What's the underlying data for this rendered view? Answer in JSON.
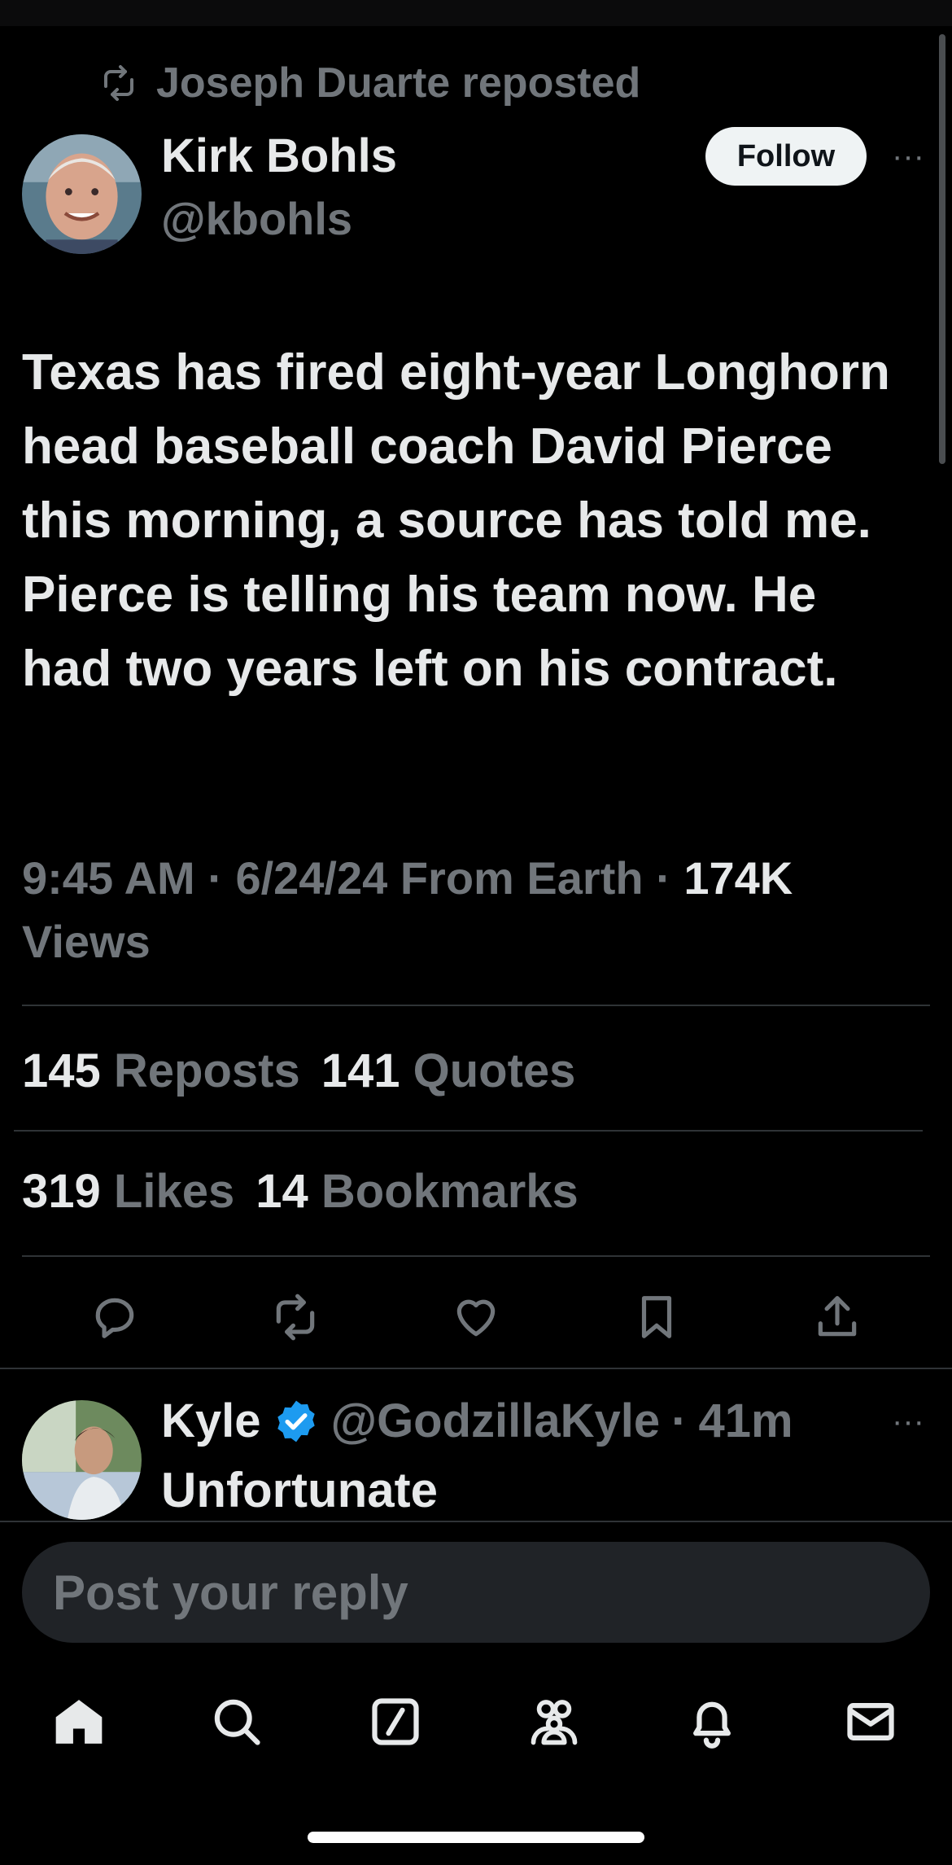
{
  "repost": {
    "text": "Joseph Duarte reposted"
  },
  "author": {
    "name": "Kirk Bohls",
    "handle": "@kbohls"
  },
  "follow_label": "Follow",
  "more_label": "···",
  "tweet": {
    "text": "Texas has fired eight-year Longhorn head baseball coach David Pierce this morning, a source has told me. Pierce is telling his team now. He had two years left on his contract.",
    "time": "9:45 AM",
    "date": "6/24/24",
    "location": "From Earth",
    "views_count": "174K",
    "views_label": "Views"
  },
  "stats": {
    "reposts": {
      "count": "145",
      "label": "Reposts"
    },
    "quotes": {
      "count": "141",
      "label": "Quotes"
    },
    "likes": {
      "count": "319",
      "label": "Likes"
    },
    "bookmarks": {
      "count": "14",
      "label": "Bookmarks"
    }
  },
  "actions": [
    "reply-icon",
    "repost-icon",
    "like-icon",
    "bookmark-icon",
    "share-icon"
  ],
  "reply": {
    "name": "Kyle",
    "handle": "@GodzillaKyle",
    "time": "41m",
    "text": "Unfortunate"
  },
  "composer": {
    "placeholder": "Post your reply"
  },
  "tabs": [
    "home-icon",
    "search-icon",
    "grok-icon",
    "communities-icon",
    "notifications-icon",
    "messages-icon"
  ],
  "colors": {
    "background": "#000000",
    "text": "#e7e9ea",
    "muted": "#71767b",
    "divider": "#2f3336",
    "verified": "#1d9bf0"
  }
}
